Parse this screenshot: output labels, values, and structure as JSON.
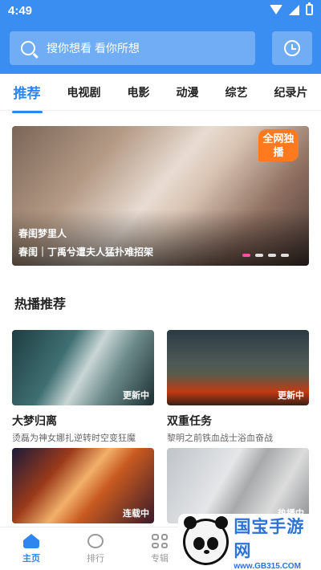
{
  "status_bar": {
    "time": "4:49"
  },
  "search": {
    "placeholder": "搜你想看 看你所想"
  },
  "tabs": [
    {
      "label": "推荐",
      "active": true
    },
    {
      "label": "电视剧"
    },
    {
      "label": "电影"
    },
    {
      "label": "动漫"
    },
    {
      "label": "综艺"
    },
    {
      "label": "纪录片"
    }
  ],
  "banner": {
    "overlay_title": "春闺梦里人",
    "caption": "春闺｜丁禹兮遭夫人猛扑难招架",
    "badge": "全网独播",
    "slide_count": 4,
    "active_slide": 1
  },
  "section": {
    "title": "热播推荐"
  },
  "cards": [
    {
      "title": "大梦归离",
      "desc": "烫磊为神女娜扎逆转时空变狂魔",
      "status": "更新中"
    },
    {
      "title": "双重任务",
      "desc": "黎明之前铁血战士浴血奋战",
      "status": "更新中"
    },
    {
      "title": "",
      "desc": "",
      "status": "连载中"
    },
    {
      "title": "",
      "desc": "",
      "status": "热播中"
    }
  ],
  "bottom_nav": [
    {
      "label": "主页",
      "icon": "home-icon",
      "active": true
    },
    {
      "label": "排行",
      "icon": "rank-icon"
    },
    {
      "label": "专辑",
      "icon": "album-icon"
    }
  ],
  "watermark": {
    "title": "国宝手游网",
    "url": "www.GB315.COM"
  },
  "colors": {
    "brand": "#3a8ef2",
    "tab_active": "#2f86f0",
    "badge": "#ff7a1f",
    "dot_active": "#ff4fa0"
  }
}
